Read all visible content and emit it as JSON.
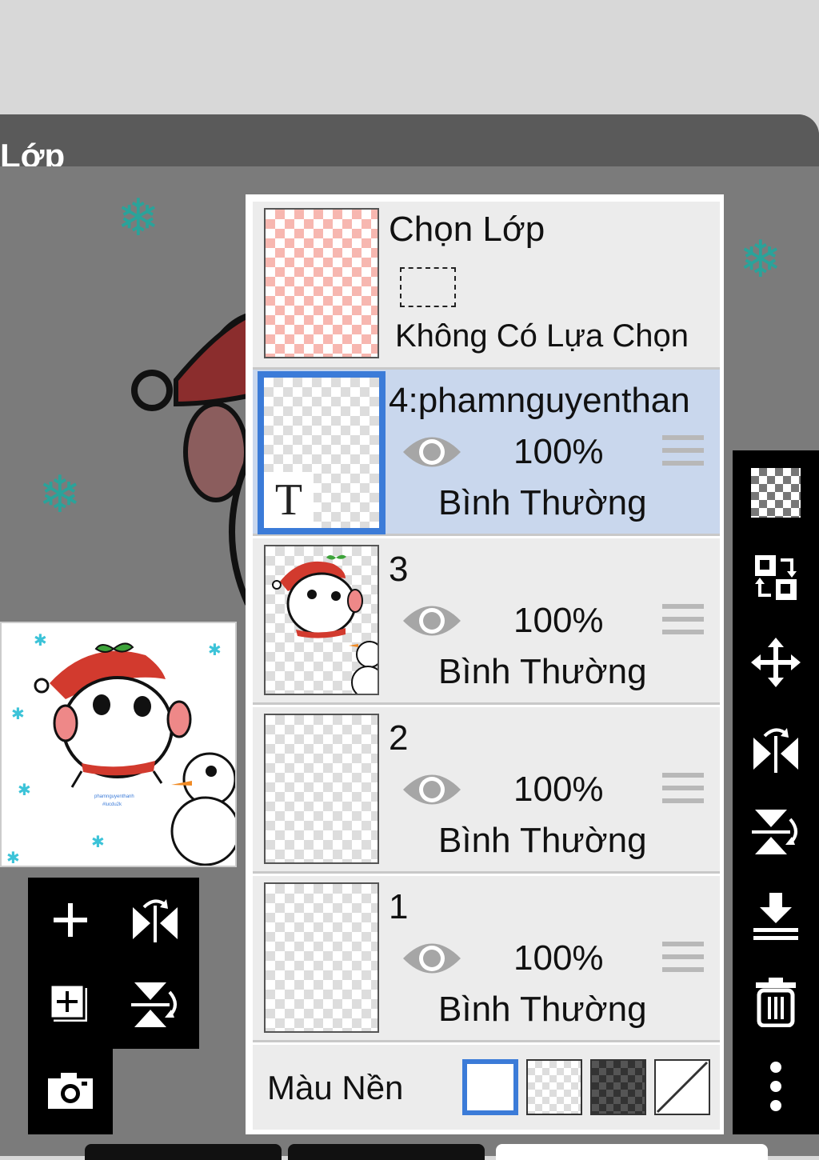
{
  "dialog": {
    "title": "Lớp"
  },
  "selection_layer": {
    "title": "Chọn Lớp",
    "status": "Không Có Lựa Chọn"
  },
  "layers": [
    {
      "name": "4:phamnguyenthan",
      "opacity": "100%",
      "blend": "Bình Thường",
      "active": true,
      "visible": true,
      "type": "text"
    },
    {
      "name": "3",
      "opacity": "100%",
      "blend": "Bình Thường",
      "active": false,
      "visible": true
    },
    {
      "name": "2",
      "opacity": "100%",
      "blend": "Bình Thường",
      "active": false,
      "visible": true
    },
    {
      "name": "1",
      "opacity": "100%",
      "blend": "Bình Thường",
      "active": false,
      "visible": true
    }
  ],
  "background": {
    "label": "Màu Nền",
    "options": [
      "white",
      "transparent",
      "dark-checker",
      "none"
    ],
    "selected": "white"
  },
  "left_tools": [
    "add-layer-icon",
    "flip-horizontal-icon",
    "duplicate-layer-icon",
    "flip-vertical-icon",
    "camera-icon"
  ],
  "right_tools": [
    "transparency-icon",
    "swap-layers-icon",
    "move-icon",
    "flip-horizontal-icon",
    "flip-vertical-icon",
    "merge-down-icon",
    "trash-icon",
    "more-icon"
  ],
  "colors": {
    "accent": "#3b7bd8",
    "active_layer_bg": "#c9d7ed",
    "snowflake": "#2aa39a"
  }
}
